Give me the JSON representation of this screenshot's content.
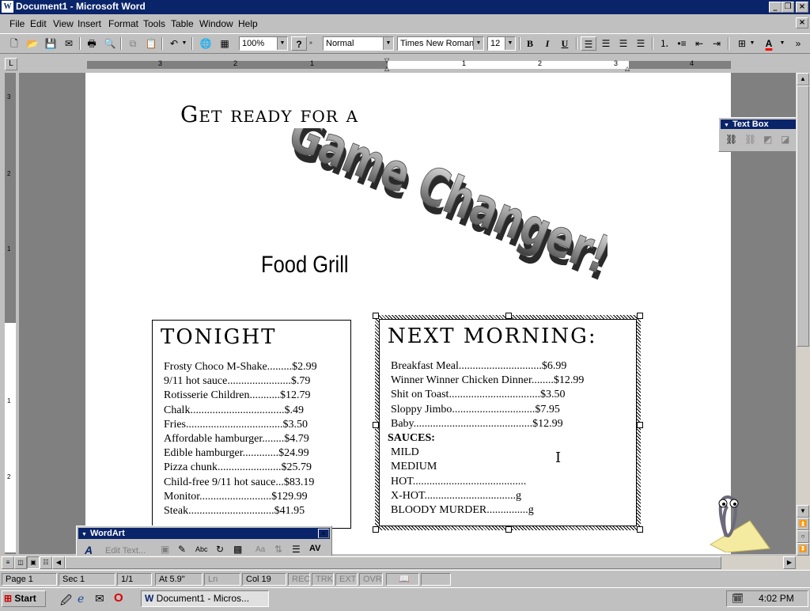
{
  "window": {
    "title": "Document1 - Microsoft Word"
  },
  "menu": [
    "File",
    "Edit",
    "View",
    "Insert",
    "Format",
    "Tools",
    "Table",
    "Window",
    "Help"
  ],
  "toolbar": {
    "zoom": "100%",
    "style": "Normal",
    "font": "Times New Roman",
    "size": "12",
    "bold": "B",
    "italic": "I",
    "underline": "U",
    "help": "?"
  },
  "ruler": {
    "top_numbers": [
      "3",
      "2",
      "1",
      "1",
      "2",
      "3",
      "4"
    ],
    "left_numbers": [
      "3",
      "2",
      "1",
      "1",
      "2"
    ]
  },
  "document": {
    "headline": "Get ready for a",
    "wordart": "Game Changer!",
    "subtitle": "Food Grill",
    "tonight": {
      "title": "TONIGHT",
      "items": [
        "Frosty Choco M-Shake.........$2.99",
        "9/11 hot sauce.......................$.79",
        "Rotisserie Children...........$12.79",
        "Chalk..................................$.49",
        "Fries...................................$3.50",
        "Affordable hamburger........$4.79",
        "Edible hamburger.............$24.99",
        "Pizza chunk.......................$25.79",
        "Child-free 9/11 hot sauce...$83.19",
        "Monitor..........................$129.99",
        "Steak...............................$41.95"
      ]
    },
    "morning": {
      "title": "NEXT MORNING:",
      "items": [
        "Breakfast Meal..............................$6.99",
        "Winner Winner Chicken Dinner........$12.99",
        "Shit on Toast.................................$3.50",
        "Sloppy Jimbo..............................$7.95",
        "Baby...........................................$12.99"
      ],
      "sauces_title": "SAUCES:",
      "sauces": [
        "MILD",
        "MEDIUM",
        "HOT.........................................",
        "X-HOT.................................g",
        "BLOODY MURDER...............g"
      ]
    }
  },
  "textbox_toolbar": {
    "title": "Text Box"
  },
  "wordart_toolbar": {
    "title": "WordArt",
    "edit_text": "Edit Text..."
  },
  "status": {
    "page": "Page 1",
    "sec": "Sec 1",
    "pages": "1/1",
    "at": "At 5.9\"",
    "ln": "Ln",
    "col": "Col 19",
    "rec": "REC",
    "trk": "TRK",
    "ext": "EXT",
    "ovr": "OVR"
  },
  "taskbar": {
    "start": "Start",
    "task": "Document1 - Micros...",
    "clock": "4:02 PM"
  },
  "colors": {
    "titlebar": "#0a246a",
    "workspace": "#808080",
    "face": "#c0c0c0"
  }
}
